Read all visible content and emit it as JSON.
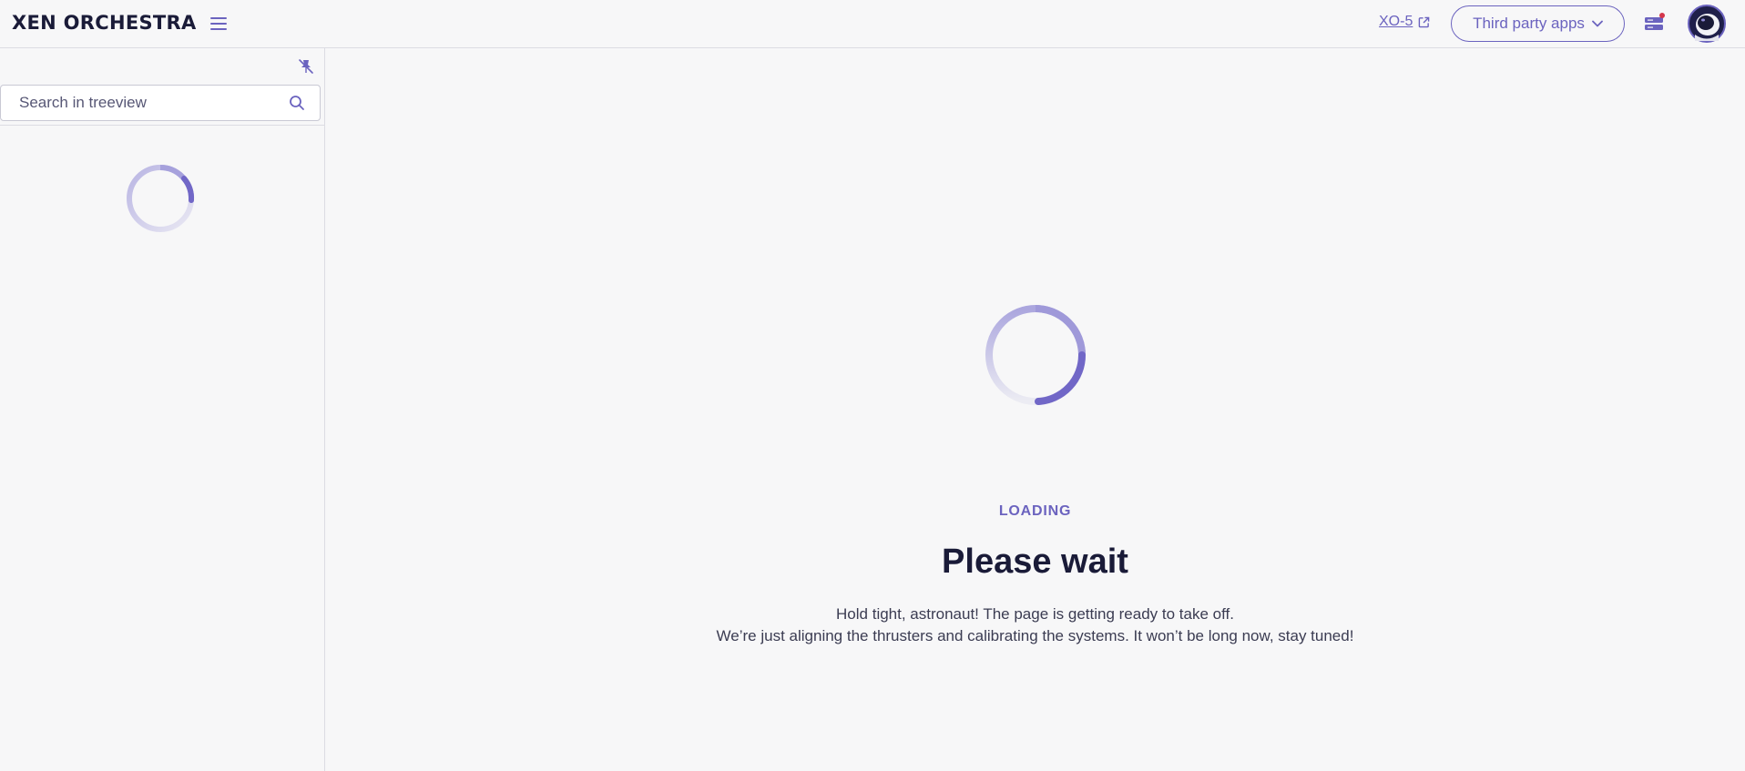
{
  "header": {
    "logo": "XEN ORCHESTRA",
    "xo_link": "XO-5",
    "third_party_label": "Third party apps"
  },
  "sidebar": {
    "search_placeholder": "Search in treeview"
  },
  "main": {
    "loading_label": "LOADING",
    "title": "Please wait",
    "description_line1": "Hold tight, astronaut! The page is getting ready to take off.",
    "description_line2": "We’re just aligning the thrusters and calibrating the systems. It won’t be long now, stay tuned!"
  },
  "colors": {
    "accent": "#6b63bf",
    "text_primary": "#1a1b38",
    "background": "#f7f7f8",
    "border": "#dcdce3",
    "notification_dot": "#d4364b"
  },
  "icons": {
    "menu": "hamburger-icon",
    "external": "external-link-icon",
    "chevron": "chevron-down-icon",
    "tasks": "tasks-icon",
    "pin": "unpin-icon",
    "search": "search-icon",
    "spinner": "spinner-icon"
  }
}
